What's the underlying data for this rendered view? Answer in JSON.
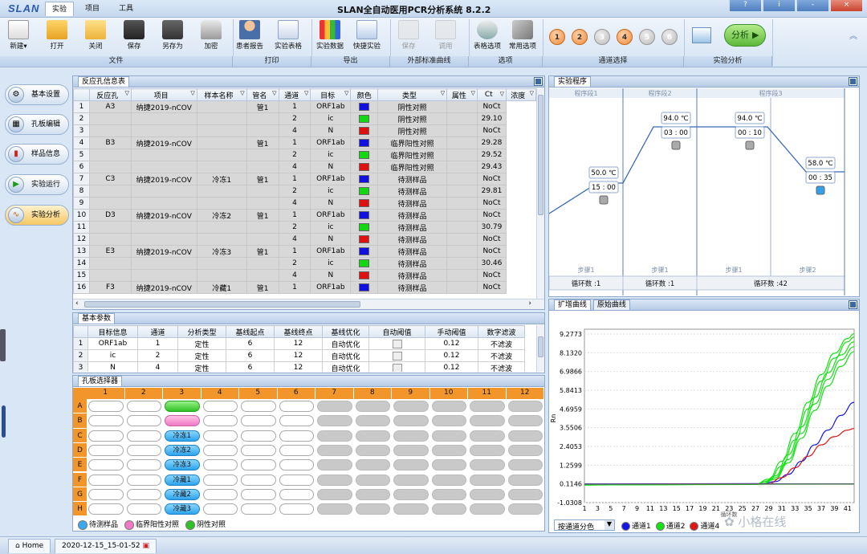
{
  "app": {
    "logo": "SLAN",
    "title": "SLAN全自动医用PCR分析系统 8.2.2",
    "menu_tabs": [
      "实验",
      "项目",
      "工具"
    ],
    "window_buttons": [
      "?",
      "i",
      "-",
      "×"
    ]
  },
  "ribbon": {
    "buttons": [
      {
        "label": "新建▾",
        "icon": "new-file-icon"
      },
      {
        "label": "打开",
        "icon": "open-folder-icon"
      },
      {
        "label": "关闭",
        "icon": "close-folder-icon"
      },
      {
        "label": "保存",
        "icon": "save-icon"
      },
      {
        "label": "另存为",
        "icon": "save-as-icon"
      },
      {
        "label": "加密",
        "icon": "lock-icon"
      },
      {
        "label": "患者报告",
        "icon": "patient-report-icon"
      },
      {
        "label": "实验表格",
        "icon": "experiment-table-icon"
      },
      {
        "label": "实验数据",
        "icon": "experiment-data-icon"
      },
      {
        "label": "快捷实验",
        "icon": "quick-experiment-icon"
      },
      {
        "label": "保存",
        "icon": "curve-save-icon",
        "disabled": true
      },
      {
        "label": "调用",
        "icon": "curve-load-icon",
        "disabled": true
      },
      {
        "label": "表格选项",
        "icon": "table-options-icon"
      },
      {
        "label": "常用选项",
        "icon": "common-options-icon"
      }
    ],
    "groups": [
      "文件",
      "打印",
      "导出",
      "外部标准曲线",
      "选项",
      "通道选择",
      "实验分析"
    ],
    "channels": [
      {
        "n": "1",
        "on": true
      },
      {
        "n": "2",
        "on": true
      },
      {
        "n": "3",
        "on": false
      },
      {
        "n": "4",
        "on": true
      },
      {
        "n": "5",
        "on": false
      },
      {
        "n": "6",
        "on": false
      }
    ],
    "analyze_label": "分析"
  },
  "nav": [
    "基本设置",
    "孔板编辑",
    "样品信息",
    "实验运行",
    "实验分析"
  ],
  "reaction": {
    "title": "反应孔信息表",
    "headers": [
      "反应孔",
      "项目",
      "样本名称",
      "管名",
      "通道",
      "目标",
      "颜色",
      "类型",
      "属性",
      "Ct",
      "浓度"
    ],
    "rows": [
      [
        "1",
        "A3",
        "纳捷2019-nCOV",
        "",
        "管1",
        "1",
        "ORF1ab",
        "#1010e0",
        "阴性对照",
        "",
        "NoCt"
      ],
      [
        "2",
        "",
        "",
        "",
        "",
        "2",
        "ic",
        "#12d812",
        "阴性对照",
        "",
        "29.10"
      ],
      [
        "3",
        "",
        "",
        "",
        "",
        "4",
        "N",
        "#e01010",
        "阴性对照",
        "",
        "NoCt"
      ],
      [
        "4",
        "B3",
        "纳捷2019-nCOV",
        "",
        "管1",
        "1",
        "ORF1ab",
        "#1010e0",
        "临界阳性对照",
        "",
        "29.28"
      ],
      [
        "5",
        "",
        "",
        "",
        "",
        "2",
        "ic",
        "#12d812",
        "临界阳性对照",
        "",
        "29.52"
      ],
      [
        "6",
        "",
        "",
        "",
        "",
        "4",
        "N",
        "#e01010",
        "临界阳性对照",
        "",
        "29.43"
      ],
      [
        "7",
        "C3",
        "纳捷2019-nCOV",
        "冷冻1",
        "管1",
        "1",
        "ORF1ab",
        "#1010e0",
        "待测样品",
        "",
        "NoCt"
      ],
      [
        "8",
        "",
        "",
        "",
        "",
        "2",
        "ic",
        "#12d812",
        "待测样品",
        "",
        "29.81"
      ],
      [
        "9",
        "",
        "",
        "",
        "",
        "4",
        "N",
        "#e01010",
        "待测样品",
        "",
        "NoCt"
      ],
      [
        "10",
        "D3",
        "纳捷2019-nCOV",
        "冷冻2",
        "管1",
        "1",
        "ORF1ab",
        "#1010e0",
        "待测样品",
        "",
        "NoCt"
      ],
      [
        "11",
        "",
        "",
        "",
        "",
        "2",
        "ic",
        "#12d812",
        "待测样品",
        "",
        "30.79"
      ],
      [
        "12",
        "",
        "",
        "",
        "",
        "4",
        "N",
        "#e01010",
        "待测样品",
        "",
        "NoCt"
      ],
      [
        "13",
        "E3",
        "纳捷2019-nCOV",
        "冷冻3",
        "管1",
        "1",
        "ORF1ab",
        "#1010e0",
        "待测样品",
        "",
        "NoCt"
      ],
      [
        "14",
        "",
        "",
        "",
        "",
        "2",
        "ic",
        "#12d812",
        "待测样品",
        "",
        "30.46"
      ],
      [
        "15",
        "",
        "",
        "",
        "",
        "4",
        "N",
        "#e01010",
        "待测样品",
        "",
        "NoCt"
      ],
      [
        "16",
        "F3",
        "纳捷2019-nCOV",
        "冷藏1",
        "管1",
        "1",
        "ORF1ab",
        "#1010e0",
        "待测样品",
        "",
        "NoCt"
      ]
    ]
  },
  "params": {
    "title": "基本参数",
    "headers": [
      "目标信息",
      "通道",
      "分析类型",
      "基线起点",
      "基线终点",
      "基线优化",
      "自动阈值",
      "手动阈值",
      "数字滤波"
    ],
    "rows": [
      [
        "1",
        "ORF1ab",
        "1",
        "定性",
        "6",
        "12",
        "自动优化",
        "",
        "0.12",
        "不滤波"
      ],
      [
        "2",
        "ic",
        "2",
        "定性",
        "6",
        "12",
        "自动优化",
        "",
        "0.12",
        "不滤波"
      ],
      [
        "3",
        "N",
        "4",
        "定性",
        "6",
        "12",
        "自动优化",
        "",
        "0.12",
        "不滤波"
      ]
    ]
  },
  "plate": {
    "title": "孔板选择器",
    "cols": [
      "1",
      "2",
      "3",
      "4",
      "5",
      "6",
      "7",
      "8",
      "9",
      "10",
      "11",
      "12"
    ],
    "rows": [
      "A",
      "B",
      "C",
      "D",
      "E",
      "F",
      "G",
      "H"
    ],
    "col3": [
      {
        "style": "green",
        "label": ""
      },
      {
        "style": "pink",
        "label": ""
      },
      {
        "style": "blue",
        "label": "冷冻1"
      },
      {
        "style": "blue",
        "label": "冷冻2"
      },
      {
        "style": "blue",
        "label": "冷冻3"
      },
      {
        "style": "blue",
        "label": "冷藏1"
      },
      {
        "style": "blue",
        "label": "冷藏2"
      },
      {
        "style": "blue",
        "label": "冷藏3"
      }
    ],
    "legend": [
      {
        "label": "待测样品",
        "color": "#3aa8f0"
      },
      {
        "label": "临界阳性对照",
        "color": "#f07ac4"
      },
      {
        "label": "阴性对照",
        "color": "#2fc326"
      }
    ]
  },
  "program": {
    "title": "实验程序",
    "segments": [
      {
        "name": "程序段1",
        "steps": [
          {
            "temp": "50.0 ℃",
            "time": "15 : 00",
            "label": "步骤1"
          }
        ],
        "cycles": "循环数 :1"
      },
      {
        "name": "程序段2",
        "steps": [
          {
            "temp": "94.0 ℃",
            "time": "03 : 00",
            "label": "步骤1"
          }
        ],
        "cycles": "循环数 :1"
      },
      {
        "name": "程序段3",
        "steps": [
          {
            "temp": "94.0 ℃",
            "time": "00 : 10",
            "label": "步骤1"
          },
          {
            "temp": "58.0 ℃",
            "time": "00 : 35",
            "label": "步骤2"
          }
        ],
        "cycles": "循环数 :42"
      }
    ]
  },
  "amp": {
    "tabs": [
      "扩增曲线",
      "原始曲线"
    ],
    "select_value": "按通道分色",
    "legend": [
      {
        "label": "通道1",
        "color": "#1515e6"
      },
      {
        "label": "通道2",
        "color": "#14e014"
      },
      {
        "label": "通道4",
        "color": "#e01414"
      }
    ],
    "watermark": "小格在线"
  },
  "chart_data": {
    "type": "line",
    "ylabel": "Rn",
    "xlabel": "循环数",
    "y_ticks": [
      "9.2773",
      "8.1320",
      "6.9866",
      "5.8413",
      "4.6959",
      "3.5506",
      "2.4053",
      "1.2599",
      "0.1146",
      "-1.0308"
    ],
    "x_ticks": [
      "1",
      "3",
      "5",
      "7",
      "9",
      "11",
      "13",
      "15",
      "17",
      "19",
      "21",
      "23",
      "25",
      "27",
      "29",
      "31",
      "33",
      "35",
      "37",
      "39",
      "41"
    ],
    "ylim": [
      -1.0308,
      9.2773
    ],
    "xlim": [
      1,
      42
    ],
    "series": [
      {
        "name": "通道1",
        "color": "#1515e6",
        "points": [
          [
            1,
            0.11
          ],
          [
            28,
            0.13
          ],
          [
            30,
            0.25
          ],
          [
            32,
            0.7
          ],
          [
            34,
            1.5
          ],
          [
            36,
            2.5
          ],
          [
            38,
            3.4
          ],
          [
            40,
            4.3
          ],
          [
            42,
            5.1
          ]
        ]
      },
      {
        "name": "通道2",
        "color": "#14e014",
        "points": [
          [
            1,
            0.05
          ],
          [
            27,
            0.08
          ],
          [
            29,
            0.3
          ],
          [
            31,
            1.2
          ],
          [
            33,
            2.8
          ],
          [
            35,
            4.7
          ],
          [
            37,
            6.4
          ],
          [
            39,
            7.8
          ],
          [
            41,
            8.8
          ],
          [
            42,
            9.1
          ]
        ]
      },
      {
        "name": "通道2",
        "color": "#14e014",
        "points": [
          [
            1,
            0.05
          ],
          [
            27,
            0.1
          ],
          [
            29,
            0.4
          ],
          [
            31,
            1.5
          ],
          [
            33,
            3.2
          ],
          [
            35,
            5.1
          ],
          [
            37,
            6.8
          ],
          [
            39,
            8.1
          ],
          [
            41,
            9.0
          ],
          [
            42,
            9.3
          ]
        ]
      },
      {
        "name": "通道2",
        "color": "#14e014",
        "points": [
          [
            1,
            0.05
          ],
          [
            28,
            0.1
          ],
          [
            30,
            0.5
          ],
          [
            32,
            1.6
          ],
          [
            34,
            3.2
          ],
          [
            36,
            5.0
          ],
          [
            38,
            6.5
          ],
          [
            40,
            7.7
          ],
          [
            42,
            8.5
          ]
        ]
      },
      {
        "name": "通道2",
        "color": "#14e014",
        "points": [
          [
            1,
            0.05
          ],
          [
            28,
            0.1
          ],
          [
            30,
            0.4
          ],
          [
            32,
            1.4
          ],
          [
            34,
            2.9
          ],
          [
            36,
            4.6
          ],
          [
            38,
            6.1
          ],
          [
            40,
            7.3
          ],
          [
            42,
            8.2
          ]
        ]
      },
      {
        "name": "通道2",
        "color": "#14e014",
        "points": [
          [
            1,
            0.05
          ],
          [
            28,
            0.12
          ],
          [
            30,
            0.6
          ],
          [
            32,
            1.9
          ],
          [
            34,
            3.6
          ],
          [
            36,
            5.4
          ],
          [
            38,
            6.9
          ],
          [
            40,
            8.0
          ],
          [
            42,
            8.8
          ]
        ]
      },
      {
        "name": "通道4",
        "color": "#e01414",
        "points": [
          [
            1,
            0.09
          ],
          [
            29,
            0.12
          ],
          [
            31,
            0.5
          ],
          [
            33,
            1.1
          ],
          [
            35,
            1.8
          ],
          [
            37,
            2.5
          ],
          [
            39,
            3.0
          ],
          [
            41,
            3.4
          ],
          [
            42,
            3.5
          ]
        ]
      },
      {
        "name": "通道1",
        "color": "#6a20a0",
        "points": [
          [
            1,
            0.1
          ],
          [
            42,
            0.12
          ]
        ]
      },
      {
        "name": "通道4",
        "color": "#4a8c4a",
        "points": [
          [
            1,
            0.08
          ],
          [
            42,
            0.1
          ]
        ]
      }
    ]
  },
  "status": {
    "home": "Home",
    "file": "2020-12-15_15-01-52"
  }
}
